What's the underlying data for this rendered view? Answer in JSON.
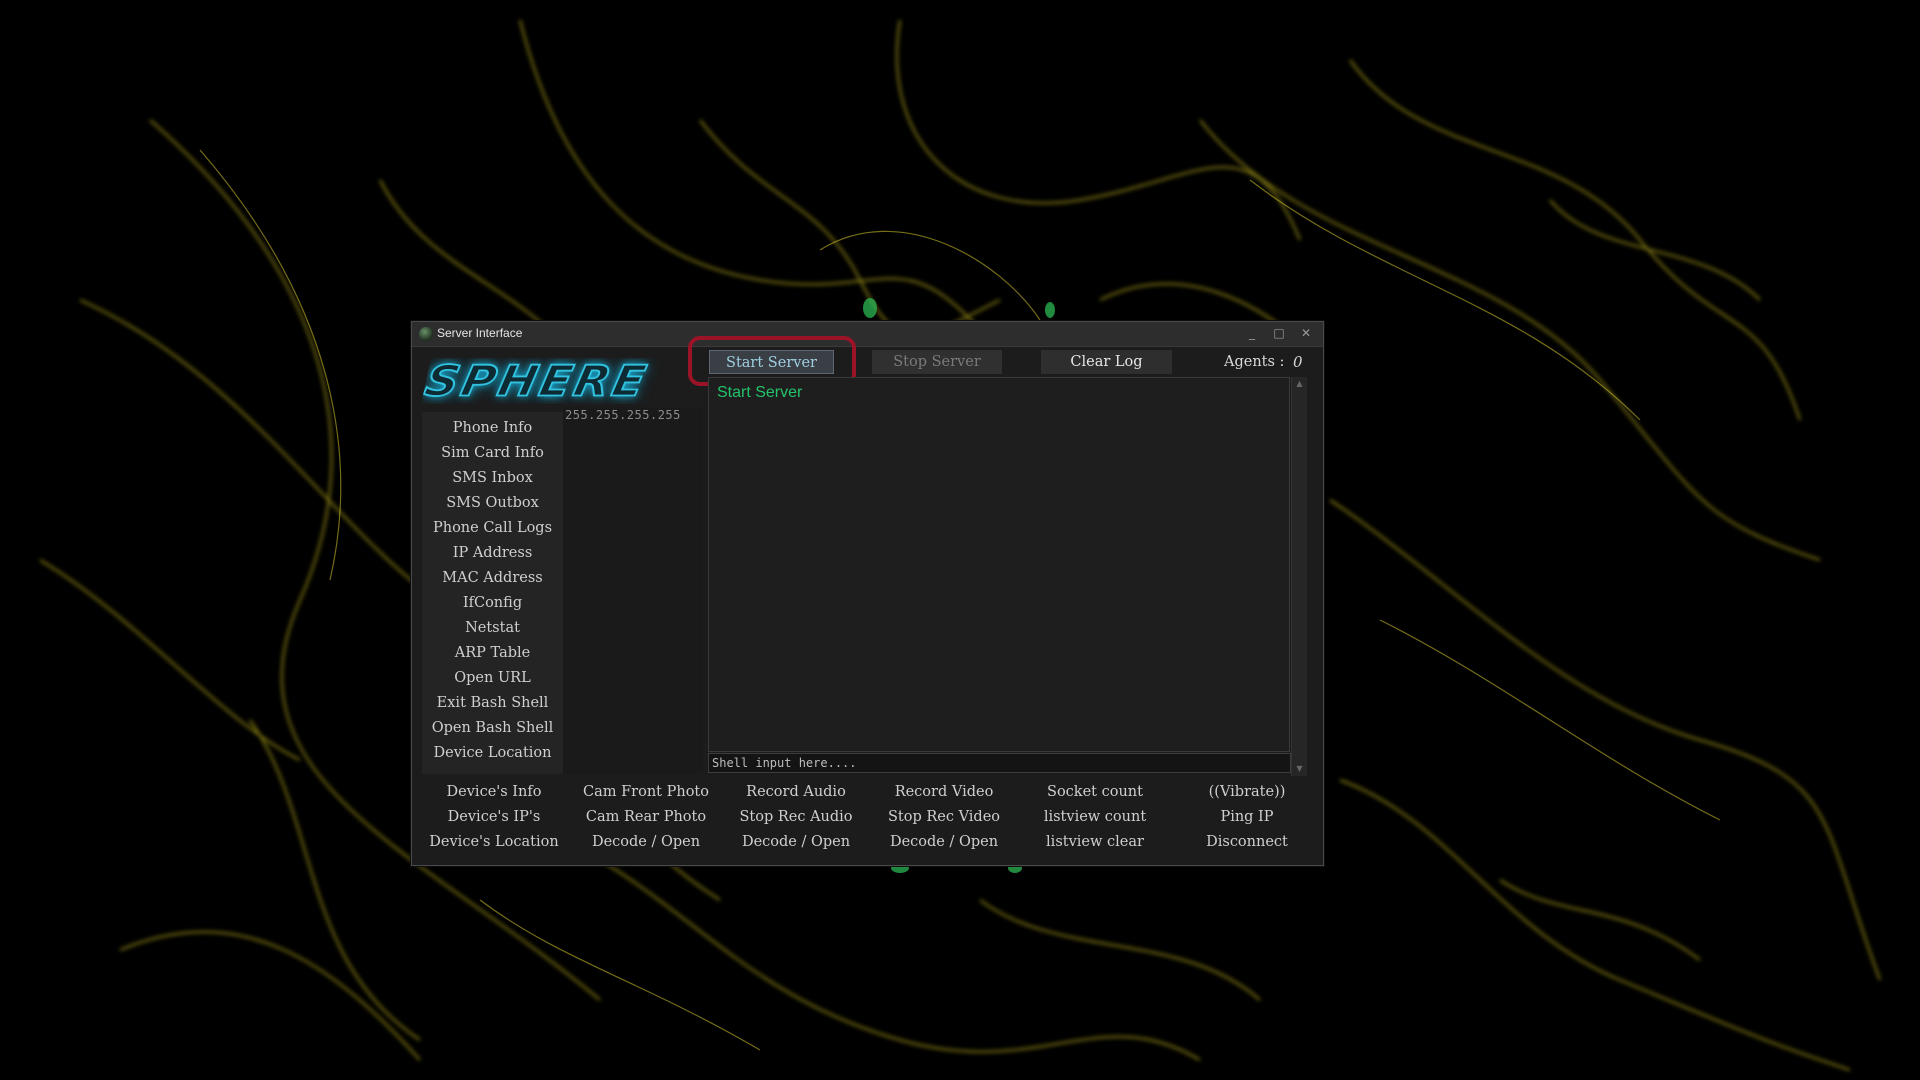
{
  "window": {
    "title": "Server Interface",
    "controls": {
      "minimize": "_",
      "maximize": "□",
      "close": "✕"
    }
  },
  "logo": {
    "text": "SPHERE"
  },
  "commands": [
    "Phone Info",
    "Sim Card Info",
    "SMS Inbox",
    "SMS Outbox",
    "Phone Call Logs",
    "IP Address",
    "MAC Address",
    "IfConfig",
    "Netstat",
    "ARP Table",
    "Open URL",
    "Exit Bash Shell",
    "Open Bash Shell",
    "Device Location"
  ],
  "clients": {
    "ip": "255.255.255.255"
  },
  "toolbar": {
    "start": "Start Server",
    "stop": "Stop Server",
    "clear": "Clear Log",
    "agents_label": "Agents :",
    "agents_count": "0"
  },
  "log": {
    "lines": [
      "Start Server"
    ]
  },
  "shell": {
    "placeholder": "Shell input here...."
  },
  "bottom_actions": {
    "col1": [
      "Device's Info",
      "Device's IP's",
      "Device's Location"
    ],
    "col2": [
      "Cam Front Photo",
      "Cam Rear Photo",
      "Decode / Open"
    ],
    "col3": [
      "Record Audio",
      "Stop Rec Audio",
      "Decode / Open"
    ],
    "col4": [
      "Record Video",
      "Stop Rec Video",
      "Decode / Open"
    ],
    "col5": [
      "Socket count",
      "listview count",
      "listview clear"
    ],
    "col6": [
      "((Vibrate))",
      "Ping IP",
      "Disconnect"
    ]
  },
  "colors": {
    "log_text": "#22c46a",
    "logo_glow": "#31c3e0",
    "highlight": "#9a1327",
    "smoke": "#b5a81c"
  }
}
